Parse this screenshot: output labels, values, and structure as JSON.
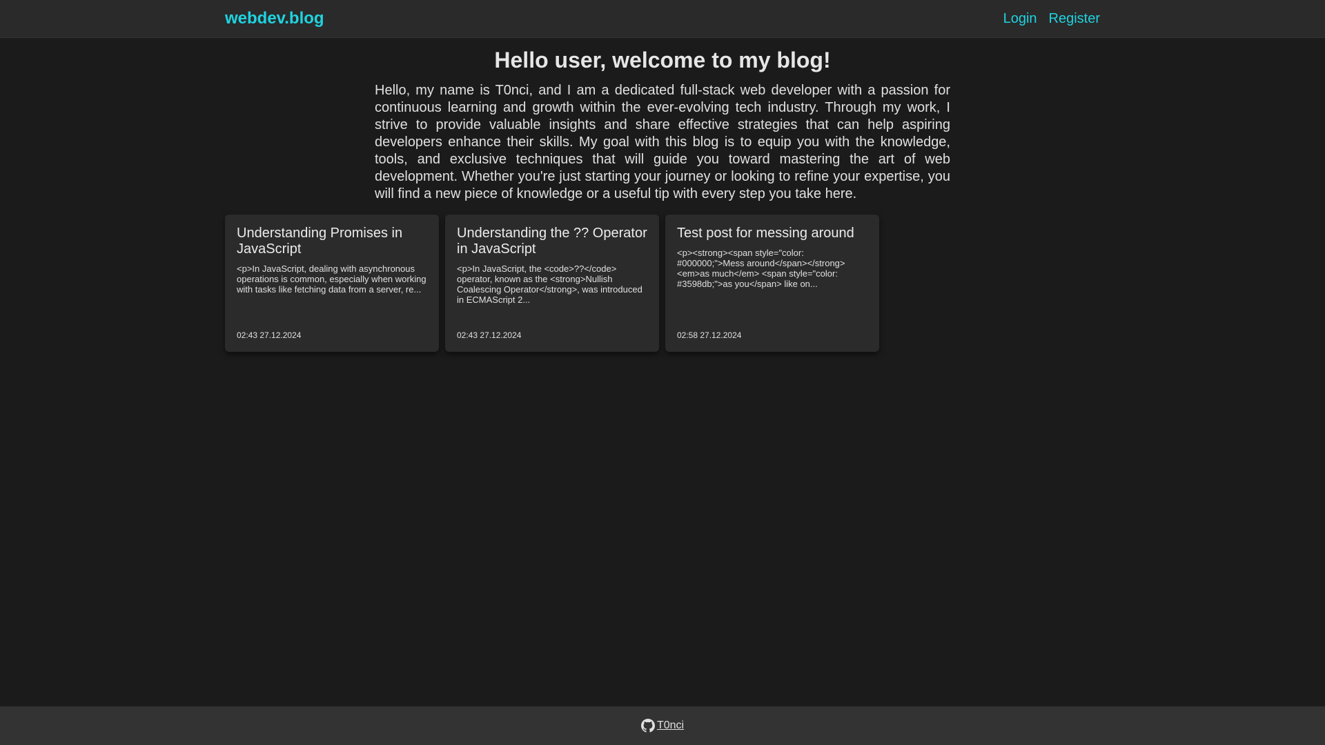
{
  "nav": {
    "brand": "webdev.blog",
    "links": [
      "Login",
      "Register"
    ]
  },
  "welcome": {
    "title": "Hello user, welcome to my blog!",
    "text": "Hello, my name is T0nci, and I am a dedicated full-stack web developer with a passion for continuous learning and growth within the ever-evolving tech industry. Through my work, I strive to provide valuable insights and share effective strategies that can help aspiring developers enhance their skills. My goal with this blog is to equip you with the knowledge, tools, and exclusive techniques that will guide you toward mastering the art of web development. Whether you're just starting your journey or looking to refine your expertise, you will find a new piece of knowledge or a useful tip with every step you take here."
  },
  "posts": [
    {
      "title": "Understanding Promises in JavaScript",
      "excerpt": "<p>In JavaScript, dealing with asynchronous operations is common, especially when working with tasks like fetching data from a server, re...",
      "date": "02:43 27.12.2024"
    },
    {
      "title": "Understanding the ?? Operator in JavaScript",
      "excerpt": "<p>In JavaScript, the <code>??</code> operator, known as the <strong>Nullish Coalescing Operator</strong>, was introduced in ECMAScript 2...",
      "date": "02:43 27.12.2024"
    },
    {
      "title": "Test post for messing around",
      "excerpt": "<p><strong><span style=\"color: #000000;\">Mess around</span></strong> <em>as much</em> <span style=\"color: #3598db;\">as you</span> like on...",
      "date": "02:58 27.12.2024"
    }
  ],
  "footer": {
    "github_user": "T0nci",
    "icon": "github-icon"
  },
  "colors": {
    "accent": "#1fd3e0",
    "background": "#1b1b1b",
    "card": "#2b2b2b",
    "navbar": "#2a2a2a",
    "footer": "#333333"
  }
}
